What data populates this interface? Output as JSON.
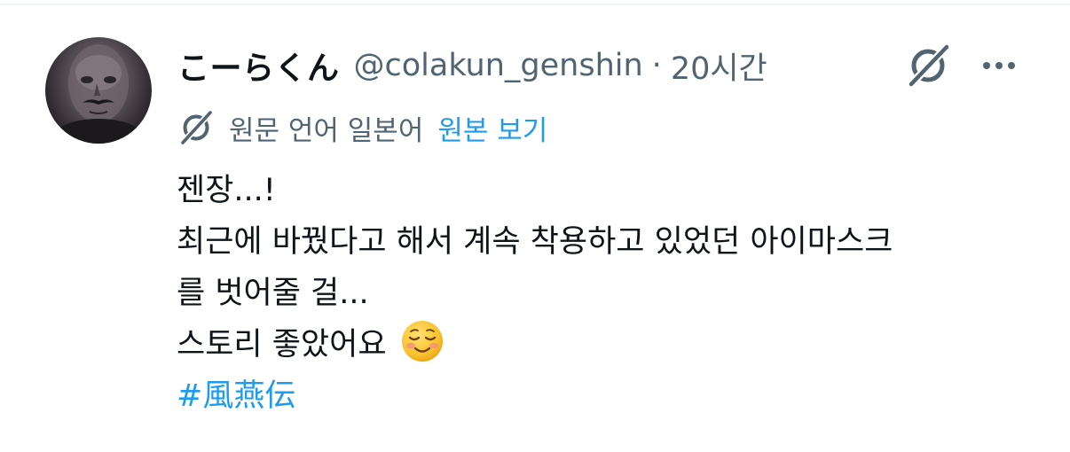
{
  "tweet": {
    "author": {
      "display_name": "こーらくん",
      "handle": "@colakun_genshin",
      "avatar": "avatar"
    },
    "separator": "·",
    "time": "20시간",
    "icons": {
      "translate": "translate-icon",
      "more": "more-icon"
    },
    "translation": {
      "label": "원문 언어 일본어",
      "view_original": "원본 보기"
    },
    "body": {
      "lines": [
        "젠장...!",
        "최근에 바꿨다고 해서 계속 착용하고 있었던 아이마스크",
        "를 벗어줄 걸...",
        "스토리 좋았어요"
      ],
      "emoji": "smiling-face-emoji",
      "hashtag": "#風燕伝"
    },
    "colors": {
      "text": "#0f1419",
      "secondary": "#536471",
      "accent": "#1d9bf0"
    }
  }
}
